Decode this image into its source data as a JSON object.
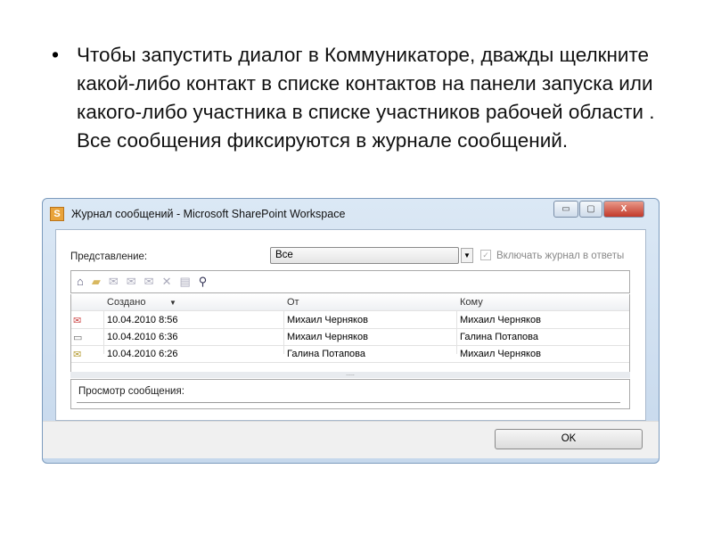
{
  "slide": {
    "bullet": "•",
    "text": "Чтобы запустить диалог в Коммуникаторе, дважды щелкните какой-либо контакт в списке контактов на панели запуска или какого-либо участника в списке участников рабочей области . Все сообщения фиксируются в журнале сообщений."
  },
  "window": {
    "app_icon": "S",
    "title": "Журнал сообщений - Microsoft SharePoint Workspace",
    "controls": {
      "minimize": "▭",
      "maximize": "▢",
      "close": "X"
    },
    "view_label": "Представление:",
    "view_value": "Все",
    "include_log_label": "Включать журнал в ответы",
    "include_log_checked": true,
    "toolbar_icons": [
      "new-icon",
      "open-icon",
      "reply-icon",
      "reply-all-icon",
      "forward-icon",
      "delete-icon",
      "print-icon",
      "find-icon"
    ],
    "columns": {
      "created": "Создано",
      "from": "От",
      "to": "Кому"
    },
    "rows": [
      {
        "icon": "unread-envelope-icon",
        "created": "10.04.2010 8:56",
        "from": "Михаил Черняков",
        "to": "Михаил Черняков"
      },
      {
        "icon": "message-card-icon",
        "created": "10.04.2010 6:36",
        "from": "Михаил Черняков",
        "to": "Галина Потапова"
      },
      {
        "icon": "read-envelope-icon",
        "created": "10.04.2010 6:26",
        "from": "Галина Потапова",
        "to": "Михаил Черняков"
      }
    ],
    "splitter": ".....",
    "preview_label": "Просмотр сообщения:",
    "ok_label": "OK"
  }
}
